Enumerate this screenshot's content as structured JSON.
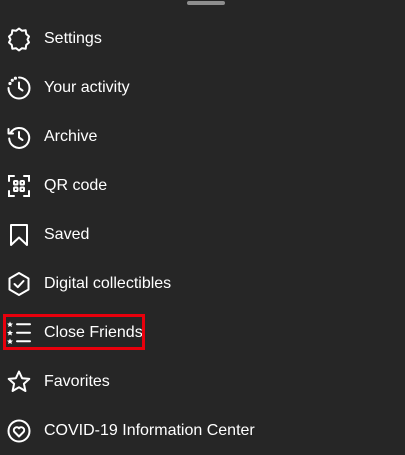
{
  "menu": {
    "items": [
      {
        "label": "Settings",
        "icon": "settings-gear-icon"
      },
      {
        "label": "Your activity",
        "icon": "activity-clock-icon"
      },
      {
        "label": "Archive",
        "icon": "archive-history-icon"
      },
      {
        "label": "QR code",
        "icon": "qr-code-icon"
      },
      {
        "label": "Saved",
        "icon": "bookmark-icon"
      },
      {
        "label": "Digital collectibles",
        "icon": "verified-badge-icon"
      },
      {
        "label": "Close Friends",
        "icon": "close-friends-list-icon"
      },
      {
        "label": "Favorites",
        "icon": "star-icon"
      },
      {
        "label": "COVID-19 Information Center",
        "icon": "covid-heart-icon"
      }
    ]
  },
  "colors": {
    "background": "#262626",
    "text": "#ffffff",
    "highlight": "#e8000c",
    "handle": "#8e8e8e"
  }
}
